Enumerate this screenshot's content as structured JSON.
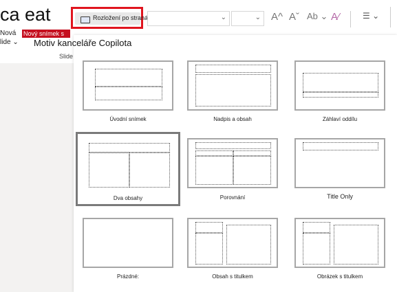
{
  "ribbon": {
    "partial_title": "ca eat",
    "new_slide_label": "Nová",
    "slide_dropdown": "lide ⌄",
    "tooltip": "Nový snímek s",
    "slides_group_label": "Slide",
    "layout_button_label": "Rozložení po stranách ▾e",
    "font_name_value": "",
    "font_size_value": "",
    "font_grow": "A^",
    "font_shrink": "Aˇ",
    "change_case": "Ab ⌄",
    "clear_format": "A⁄",
    "list_icon": "☰ ⌄"
  },
  "flyout": {
    "title": "Motiv kanceláře Copilota",
    "layouts": [
      {
        "name": "Úvodní snímek"
      },
      {
        "name": "Nadpis a obsah"
      },
      {
        "name": "Záhlaví oddílu"
      },
      {
        "name": "Dva obsahy",
        "selected": true
      },
      {
        "name": "Porovnání"
      },
      {
        "name": "Title Only"
      },
      {
        "name": "Prázdné:"
      },
      {
        "name": "Obsah s titulkem"
      },
      {
        "name": "Obrázek s titulkem"
      }
    ]
  },
  "colors": {
    "highlight_border": "#e0141e",
    "tooltip_bg": "#c50f1f",
    "thumb_border": "#a6a6a6",
    "selected_border": "#7a7a7a",
    "pane_bg": "#f3f2f1"
  }
}
